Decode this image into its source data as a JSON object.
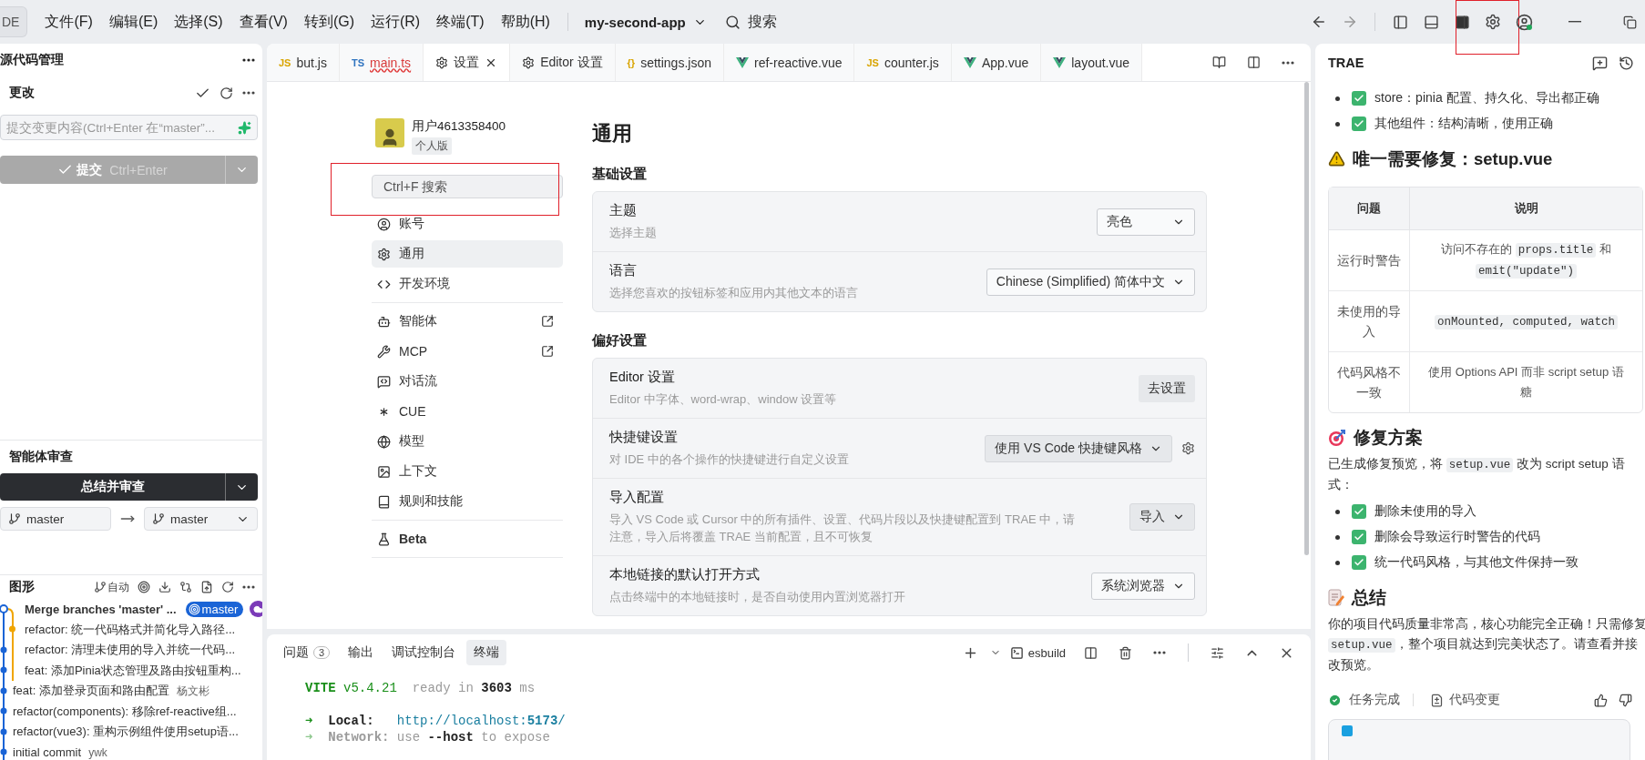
{
  "title_bar": {
    "app_button": "DE",
    "menus": [
      "文件(F)",
      "编辑(E)",
      "选择(S)",
      "查看(V)",
      "转到(G)",
      "运行(R)",
      "终端(T)",
      "帮助(H)"
    ],
    "project": "my-second-app",
    "search": "搜索",
    "layout_toggles": [
      {
        "kind": "left",
        "on": false
      },
      {
        "kind": "bottom",
        "on": false
      },
      {
        "kind": "right",
        "on": true
      }
    ],
    "settings_highlighted": true
  },
  "source_control": {
    "title": "源代码管理",
    "changes_title": "更改",
    "placeholder": "提交变更内容(Ctrl+Enter 在“master”...",
    "commit_button": "提交",
    "commit_shortcut": "Ctrl+Enter",
    "commit_disabled": true,
    "review": {
      "title": "智能体审查",
      "button": "总结并审查",
      "source_branch": "master",
      "target_branch": "master"
    },
    "graph": {
      "title": "图形",
      "auto": "自动",
      "commits": [
        {
          "kind": "merge",
          "message": "Merge branches 'master' ...",
          "head": true,
          "branch": "master",
          "remote": true
        },
        {
          "kind": "side",
          "message": "refactor: 统一代码格式并简化导入路径...",
          "head": false
        },
        {
          "kind": "merged",
          "message": "refactor: 清理未使用的导入并统一代码...",
          "head": false
        },
        {
          "kind": "merged",
          "message": "feat: 添加Pinia状态管理及路由按钮重构...",
          "head": false
        },
        {
          "kind": "main",
          "message": "feat: 添加登录页面和路由配置",
          "author": "杨文彬",
          "head": false
        },
        {
          "kind": "main",
          "message": "refactor(components): 移除ref-reactive组...",
          "head": false
        },
        {
          "kind": "main",
          "message": "refactor(vue3): 重构示例组件使用setup语...",
          "head": false
        },
        {
          "kind": "main",
          "message": "initial commit",
          "author": "ywk",
          "head": false
        }
      ]
    }
  },
  "editor": {
    "tabs": [
      {
        "kind": "js",
        "badge": "JS",
        "label": "but.js",
        "selected": false,
        "error": false
      },
      {
        "kind": "ts",
        "badge": "TS",
        "label": "main.ts",
        "selected": false,
        "error": true
      },
      {
        "kind": "settings",
        "label": "设置",
        "selected": true,
        "error": false
      },
      {
        "kind": "settings",
        "label": "Editor 设置",
        "selected": false,
        "error": false
      },
      {
        "kind": "json",
        "badge": "{}",
        "label": "settings.json",
        "selected": false,
        "error": false
      },
      {
        "kind": "vue",
        "label": "ref-reactive.vue",
        "selected": false,
        "error": false
      },
      {
        "kind": "js",
        "badge": "JS",
        "label": "counter.js",
        "selected": false,
        "error": false
      },
      {
        "kind": "vue",
        "label": "App.vue",
        "selected": false,
        "error": false
      },
      {
        "kind": "vue",
        "label": "layout.vue",
        "selected": false,
        "error": false
      }
    ],
    "settings": {
      "user": {
        "name": "用户4613358400",
        "plan": "个人版"
      },
      "search": {
        "placeholder": "Ctrl+F 搜索",
        "highlighted": true
      },
      "nav_groups": [
        {
          "items": [
            {
              "label": "账号",
              "selected": false,
              "external": false
            },
            {
              "label": "通用",
              "selected": true,
              "external": false
            },
            {
              "label": "开发环境",
              "selected": false,
              "external": false
            }
          ]
        },
        {
          "items": [
            {
              "label": "智能体",
              "selected": false,
              "external": true
            },
            {
              "label": "MCP",
              "selected": false,
              "external": true
            },
            {
              "label": "对话流",
              "selected": false,
              "external": false
            },
            {
              "label": "CUE",
              "selected": false,
              "external": false
            },
            {
              "label": "模型",
              "selected": false,
              "external": false
            },
            {
              "label": "上下文",
              "selected": false,
              "external": false
            },
            {
              "label": "规则和技能",
              "selected": false,
              "external": false
            }
          ]
        },
        {
          "items": [
            {
              "label": "Beta",
              "selected": false,
              "external": false
            }
          ]
        }
      ],
      "title": "通用",
      "sections": [
        {
          "title": "基础设置",
          "rows": [
            {
              "title": "主题",
              "description": "选择主题",
              "control": {
                "kind": "select",
                "value": "亮色",
                "gear": false
              }
            },
            {
              "title": "语言",
              "description": "选择您喜欢的按钮标签和应用内其他文本的语言",
              "control": {
                "kind": "select",
                "value": "Chinese (Simplified) 简体中文",
                "gear": false
              }
            }
          ]
        },
        {
          "title": "偏好设置",
          "rows": [
            {
              "title": "Editor 设置",
              "description": "Editor 中字体、word-wrap、window 设置等",
              "control": {
                "kind": "button",
                "value": "去设置",
                "gear": false
              }
            },
            {
              "title": "快捷键设置",
              "description": "对 IDE 中的各个操作的快捷键进行自定义设置",
              "control": {
                "kind": "filled_select",
                "value": "使用 VS Code 快捷键风格",
                "gear": true
              }
            },
            {
              "title": "导入配置",
              "description": "导入 VS Code 或 Cursor 中的所有插件、设置、代码片段以及快捷键配置到 TRAE 中，请注意，导入后将覆盖 TRAE 当前配置，且不可恢复",
              "control": {
                "kind": "filled_select",
                "value": "导入",
                "gear": false
              }
            },
            {
              "title": "本地链接的默认打开方式",
              "description": "点击终端中的本地链接时，是否自动使用内置浏览器打开",
              "control": {
                "kind": "select",
                "value": "系统浏览器",
                "gear": false
              }
            }
          ]
        }
      ]
    }
  },
  "terminal": {
    "tabs": [
      {
        "label": "问题",
        "count": "3",
        "selected": false
      },
      {
        "label": "输出",
        "selected": false
      },
      {
        "label": "调试控制台",
        "selected": false
      },
      {
        "label": "终端",
        "selected": true
      }
    ],
    "profile": "esbuild",
    "lines": [
      {
        "kind": "banner",
        "segments": [
          {
            "text": "VITE",
            "kind": "brand"
          },
          {
            "text": " v5.4.21",
            "kind": "version"
          },
          {
            "text": "  ready in ",
            "kind": "dim"
          },
          {
            "text": "3603",
            "kind": "bold"
          },
          {
            "text": " ms",
            "kind": "dim"
          }
        ]
      },
      {
        "kind": "info",
        "segments": [
          {
            "text": "➜",
            "kind": "arrow"
          },
          {
            "text": "  Local:",
            "kind": "bold"
          },
          {
            "text": "   http://localhost:",
            "kind": "link"
          },
          {
            "text": "5173",
            "kind": "link_bold"
          },
          {
            "text": "/",
            "kind": "link"
          }
        ]
      },
      {
        "kind": "info",
        "segments": [
          {
            "text": "➜",
            "kind": "arrow_dim"
          },
          {
            "text": "  Network:",
            "kind": "dim_bold"
          },
          {
            "text": " use ",
            "kind": "dim"
          },
          {
            "text": "--host",
            "kind": "bold"
          },
          {
            "text": " to expose",
            "kind": "dim"
          }
        ]
      }
    ]
  },
  "assistant": {
    "title": "TRAE",
    "blocks": [
      {
        "kind": "checklist",
        "items": [
          "store：pinia 配置、持久化、导出都正确",
          "其他组件：结构清晰，使用正确"
        ]
      },
      {
        "kind": "heading",
        "text": "唯一需要修复：setup.vue"
      },
      {
        "kind": "table",
        "columns": [
          "问题",
          "说明"
        ],
        "rows": [
          {
            "issue": "运行时警告",
            "detail": [
              [
                {
                  "text": "访问不存在的 "
                },
                {
                  "code": "props.title"
                },
                {
                  "text": " 和"
                }
              ],
              [
                {
                  "code": "emit(\"update\")"
                }
              ]
            ]
          },
          {
            "issue": "未使用的导入",
            "detail": [
              [
                {
                  "code": "onMounted, computed, watch"
                }
              ]
            ]
          },
          {
            "issue": "代码风格不一致",
            "detail": [
              [
                {
                  "text": "使用 Options API 而非 script setup 语"
                }
              ],
              [
                {
                  "text": "糖"
                }
              ]
            ]
          }
        ]
      },
      {
        "kind": "heading",
        "text": "修复方案"
      },
      {
        "kind": "paragraph",
        "lines": [
          [
            {
              "text": "已生成修复预览，将 "
            },
            {
              "code": "setup.vue"
            },
            {
              "text": " 改为 script setup 语"
            }
          ],
          [
            {
              "text": "式："
            }
          ]
        ]
      },
      {
        "kind": "checklist",
        "items": [
          "删除未使用的导入",
          "删除会导致运行时警告的代码",
          "统一代码风格，与其他文件保持一致"
        ]
      },
      {
        "kind": "heading",
        "text": "总结"
      },
      {
        "kind": "paragraph",
        "lines": [
          [
            {
              "text": "你的项目代码质量非常高，核心功能完全正确！只需修复"
            }
          ],
          [
            {
              "code": "setup.vue"
            },
            {
              "text": "，整个项目就达到完美状态了。请查看并接"
            }
          ],
          [
            {
              "text": "改预览。"
            }
          ]
        ]
      }
    ],
    "footer": {
      "status": "任务完成",
      "changes": "代码变更"
    }
  }
}
